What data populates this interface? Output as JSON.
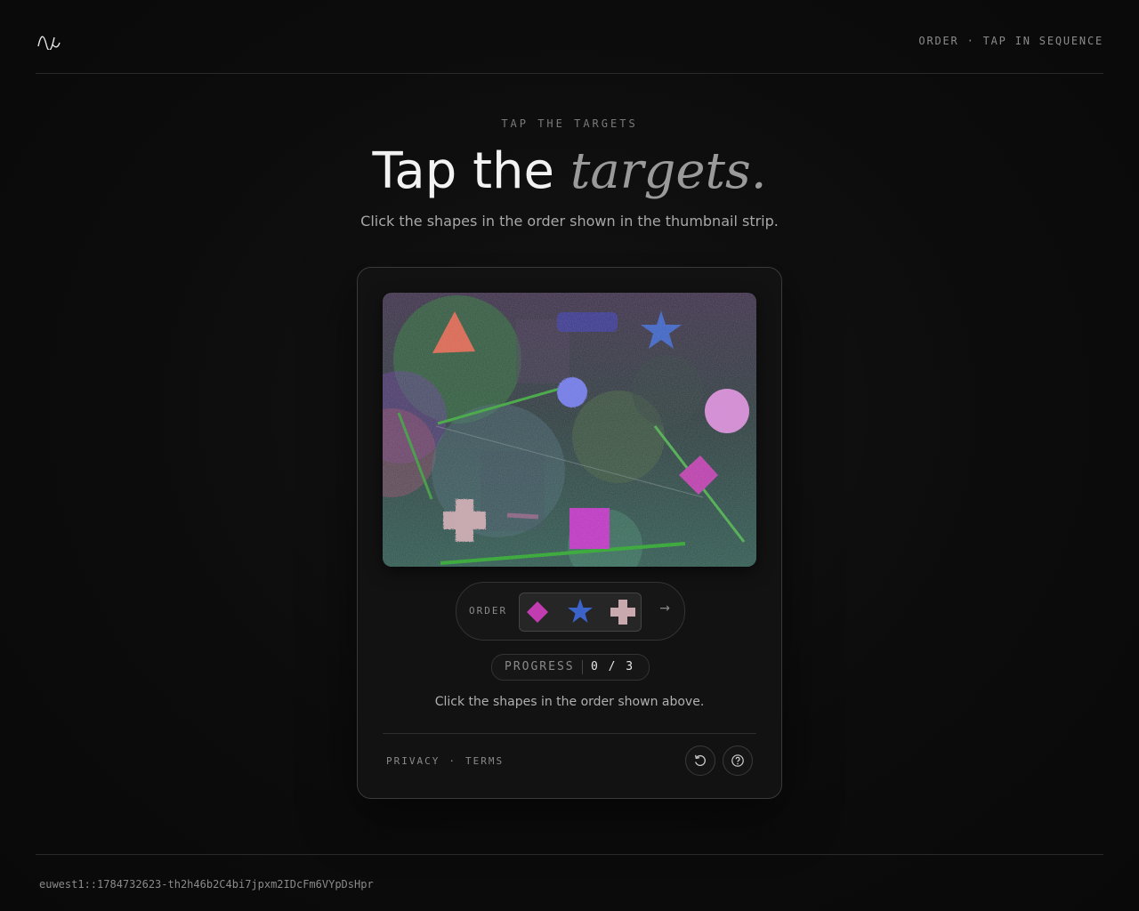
{
  "header": {
    "logo_icon": "wave-logo-icon",
    "tag": "ORDER · TAP IN SEQUENCE"
  },
  "hero": {
    "eyebrow": "TAP THE TARGETS",
    "title_plain": "Tap the",
    "title_accent": "targets.",
    "subtitle": "Click the shapes in the order shown in the thumbnail strip."
  },
  "challenge": {
    "canvas_shapes": [
      "triangle",
      "rounded-rectangle",
      "star",
      "blob",
      "circle",
      "diamond",
      "cross-blob",
      "square",
      "line",
      "line",
      "line"
    ],
    "order": {
      "label": "ORDER",
      "thumbnails": [
        "diamond",
        "star",
        "cross-blob"
      ],
      "arrow": "→"
    },
    "progress": {
      "label": "PROGRESS",
      "value": "0 / 3"
    },
    "instruction": "Click the shapes in the order shown above."
  },
  "card_footer": {
    "privacy": "PRIVACY",
    "separator": "·",
    "terms": "TERMS",
    "reload_icon": "reload-icon",
    "help_icon": "help-icon"
  },
  "footer": {
    "session_id": "euwest1::1784732623-th2h46b2C4bi7jpxm2IDcFm6VYpDsHpr"
  },
  "colors": {
    "background": "#0b0b0b",
    "card_border": "#3a3a3a",
    "triangle": "#e0664f",
    "star": "#3b63c9",
    "diamond": "#c03cb0",
    "square": "#c232c7",
    "circle": "#d88ad8",
    "blob": "#6f79ee",
    "cross_blob": "#c9a8ae"
  }
}
